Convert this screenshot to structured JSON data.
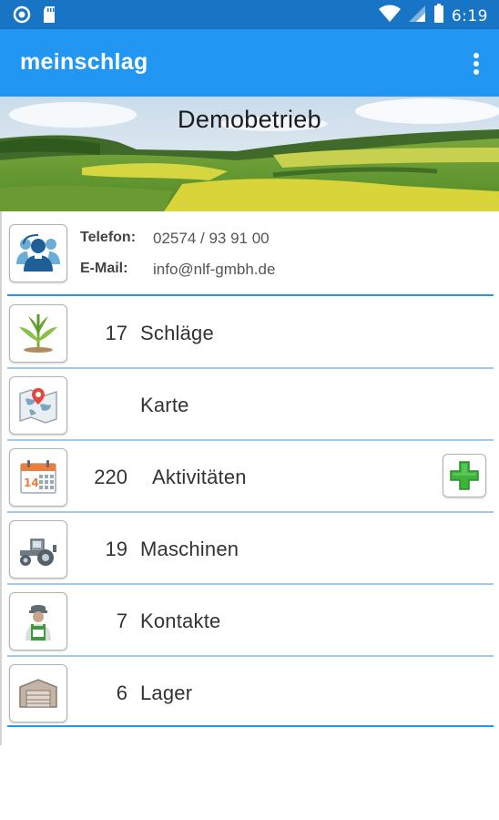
{
  "status_bar": {
    "time": "6:19",
    "icons": [
      "notification-circle-icon",
      "sd-card-icon",
      "wifi-icon",
      "signal-icon",
      "battery-icon"
    ]
  },
  "app_bar": {
    "title": "meinschlag",
    "menu_icon": "more-vert-icon"
  },
  "banner": {
    "title": "Demobetrieb"
  },
  "contact": {
    "icon": "contact-person-icon",
    "phone_label": "Telefon:",
    "phone_value": "02574 / 93 91 00",
    "email_label": "E-Mail:",
    "email_value": "info@nlf-gmbh.de"
  },
  "items": [
    {
      "count": "17",
      "label": "Schläge",
      "icon": "plant-icon"
    },
    {
      "count": "",
      "label": "Karte",
      "icon": "map-icon"
    },
    {
      "count": "220",
      "label": "Aktivitäten",
      "icon": "calendar-icon",
      "action_icon": "add-plus-icon"
    },
    {
      "count": "19",
      "label": "Maschinen",
      "icon": "tractor-icon"
    },
    {
      "count": "7",
      "label": "Kontakte",
      "icon": "farmer-icon"
    },
    {
      "count": "6",
      "label": "Lager",
      "icon": "warehouse-icon"
    }
  ],
  "colors": {
    "status_bar": "#1874c4",
    "app_bar": "#2196f3",
    "separator": "#2196f3",
    "add_green": "#3cb43c"
  }
}
